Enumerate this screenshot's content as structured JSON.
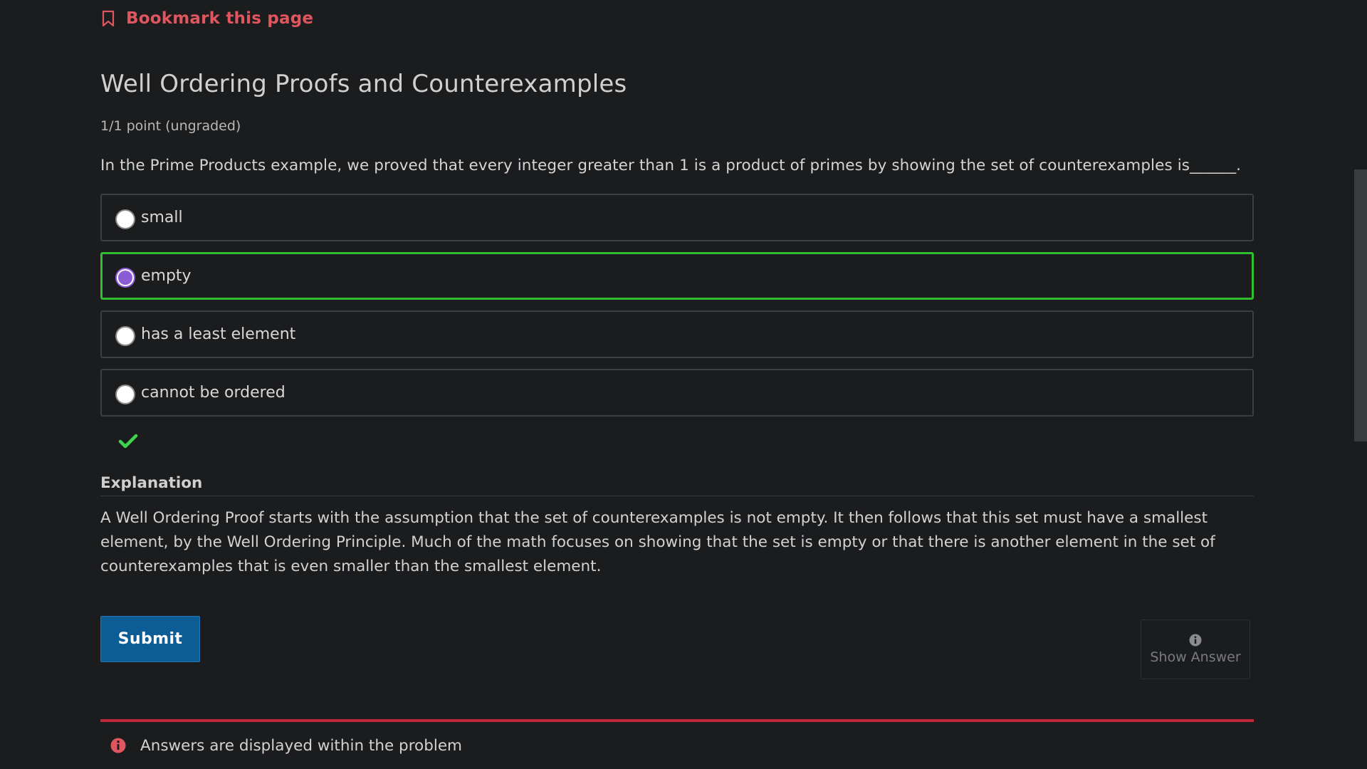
{
  "bookmark": {
    "label": "Bookmark this page"
  },
  "problem": {
    "title": "Well Ordering Proofs and Counterexamples",
    "points": "1/1 point (ungraded)",
    "question": "In the Prime Products example, we proved that every integer greater than 1 is a product of primes by showing the set of counterexamples is______.",
    "choices": [
      {
        "label": "small",
        "selected": false
      },
      {
        "label": "empty",
        "selected": true,
        "correct": true
      },
      {
        "label": "has a least element",
        "selected": false
      },
      {
        "label": "cannot be ordered",
        "selected": false
      }
    ],
    "status_icon": "checkmark-icon"
  },
  "explanation": {
    "heading": "Explanation",
    "text": "A Well Ordering Proof starts with the assumption that the set of counterexamples is not empty. It then follows that this set must have a smallest element, by the Well Ordering Principle. Much of the math focuses on showing that the set is empty or that there is another element in the set of counterexamples that is even smaller than the smallest element."
  },
  "actions": {
    "submit_label": "Submit",
    "show_answer_label": "Show Answer"
  },
  "notice": {
    "text": "Answers are displayed within the problem"
  },
  "colors": {
    "background": "#1b1c1e",
    "bookmark": "#e0565f",
    "correct_border": "#2fbf2f",
    "selected_radio": "#8b5cd6",
    "submit": "#0c5c96",
    "notice_border": "#c1283a"
  }
}
